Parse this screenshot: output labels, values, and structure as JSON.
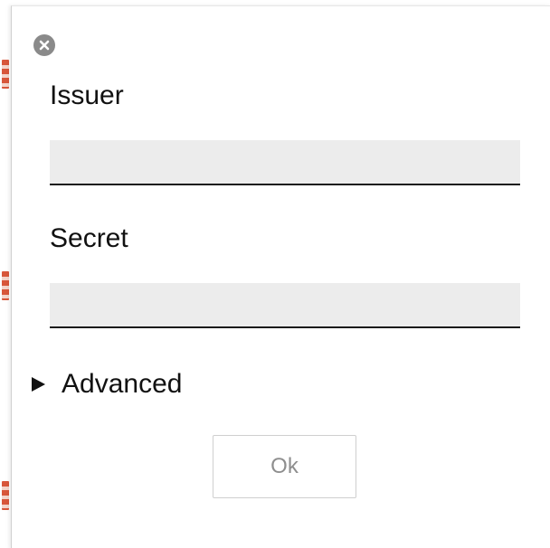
{
  "dialog": {
    "close_icon": "close-circle-icon",
    "fields": [
      {
        "label": "Issuer",
        "value": "",
        "placeholder": ""
      },
      {
        "label": "Secret",
        "value": "",
        "placeholder": ""
      }
    ],
    "advanced": {
      "label": "Advanced",
      "icon": "disclosure-triangle-right-icon",
      "expanded": false
    },
    "ok_label": "Ok"
  },
  "colors": {
    "input_background": "#ececec",
    "input_underline": "#1a1a1a",
    "close_icon": "#8a8a8a",
    "ok_text": "#8e8e8e",
    "page_edge_accent": "#d8563a"
  }
}
